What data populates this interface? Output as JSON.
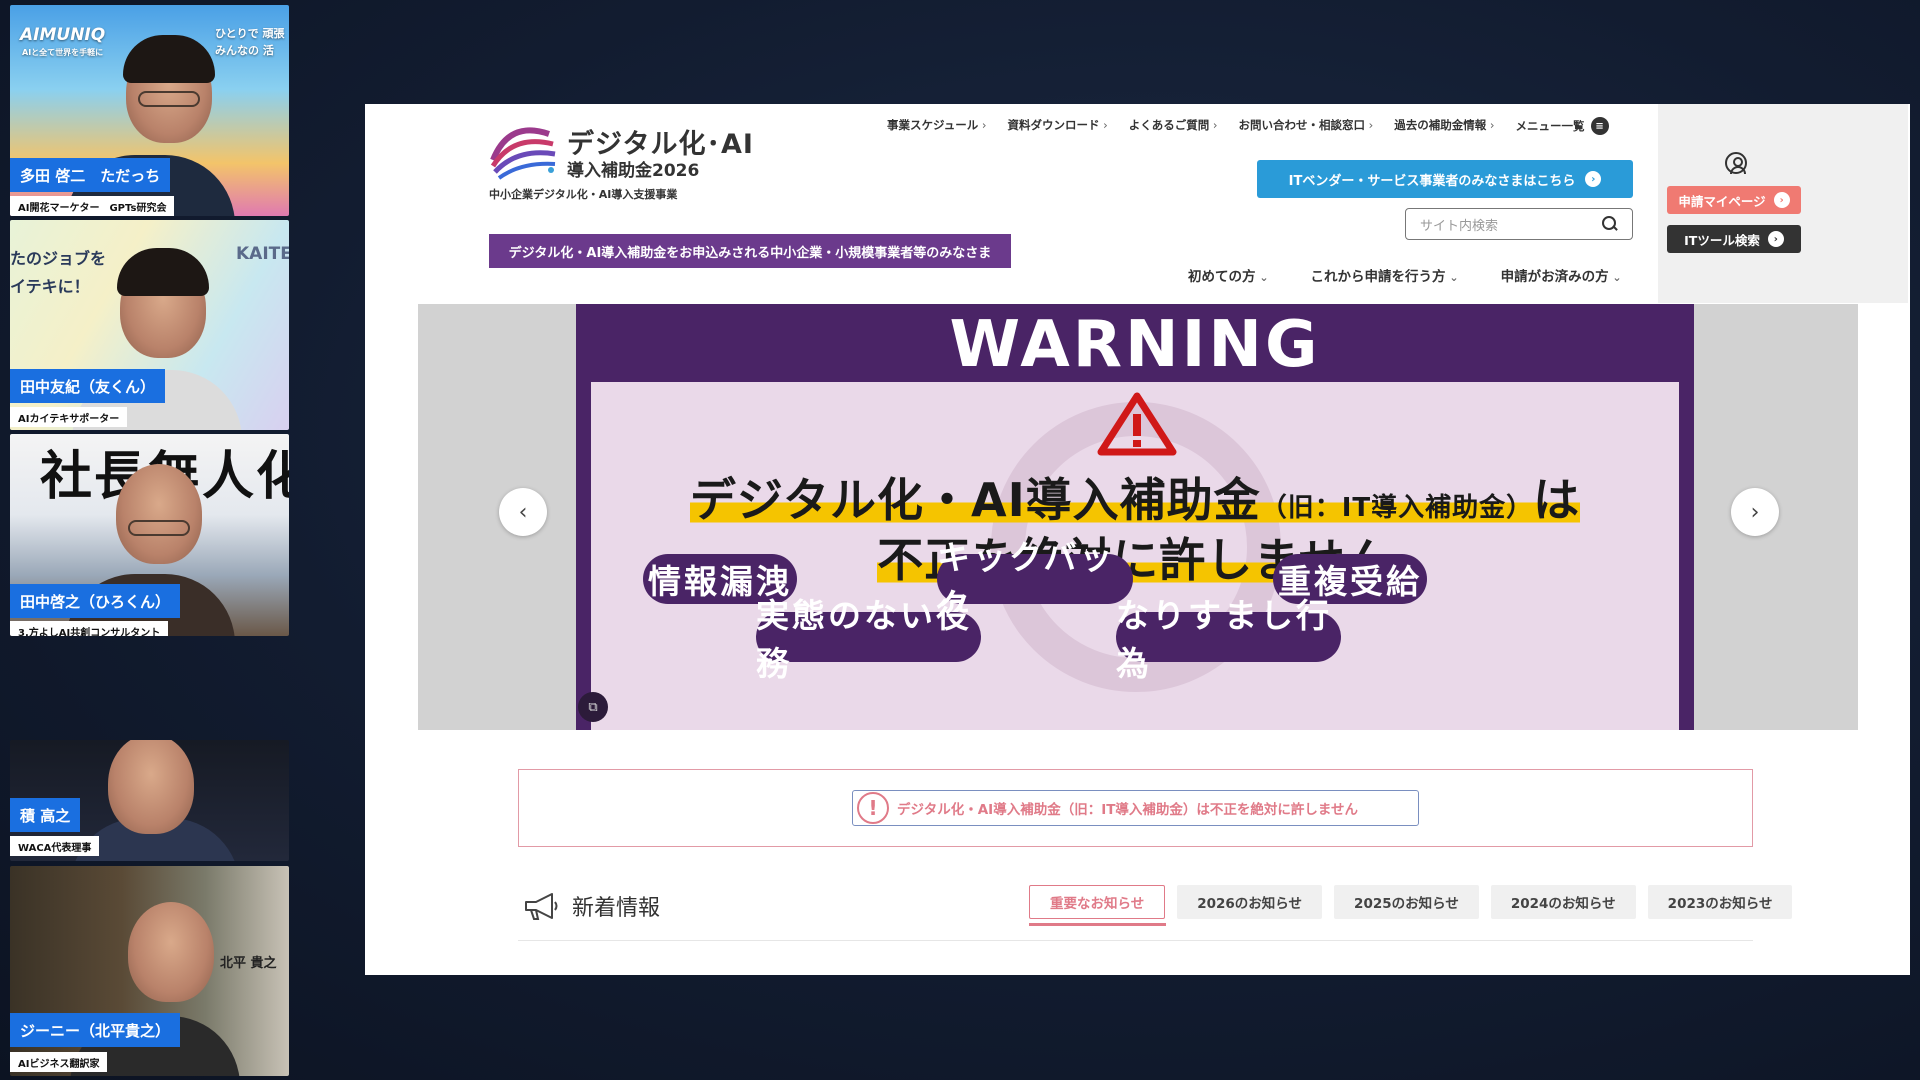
{
  "participants": [
    {
      "name": "多田 啓二　ただっち",
      "title": "AI開花マーケター　GPTs研究会",
      "overlay_brand": "AIMUNIQ",
      "overlay_tagline": "AIと全て世界を手軽に",
      "overlay_right": "ひとりで 頑張\nみんなの 活"
    },
    {
      "name": "田中友紀（友くん）",
      "title": "AIカイテキサポーター",
      "overlay_left": "たのジョブを\nイテキに！",
      "overlay_right": "KAITE"
    },
    {
      "name": "田中啓之（ひろくん）",
      "title": "3.方よしAI共創コンサルタント",
      "overlay_top": "社長無人化"
    },
    {
      "name": "積 高之",
      "title": "WACA代表理事"
    },
    {
      "name": "ジーニー（北平貴之）",
      "title": "AIビジネス翻訳家",
      "overlay_right": "北平 貴之"
    }
  ],
  "site": {
    "logo_line1": "デジタル化･AI",
    "logo_line2": "導入補助金2026",
    "logo_sub": "中小企業デジタル化・AI導入支援事業",
    "top_nav": [
      "事業スケジュール",
      "資料ダウンロード",
      "よくあるご質問",
      "お問い合わせ・相談窓口",
      "過去の補助金情報"
    ],
    "menu_all": "メニュー一覧",
    "vendor_button": "ITベンダー・サービス事業者のみなさまはこちら",
    "search_placeholder": "サイト内検索",
    "purple_banner": "デジタル化・AI導入補助金をお申込みされる中小企業・小規模事業者等のみなさま",
    "main_nav": [
      "初めての方",
      "これから申請を行う方",
      "申請がお済みの方"
    ],
    "mypage_button": "申請マイページ",
    "tool_search_button": "ITツール検索",
    "slide": {
      "title": "WARNING",
      "headline_main": "デジタル化・AI導入補助金",
      "headline_small": "（旧：IT導入補助金）",
      "headline_tail": "は",
      "headline2": "不正を絶対に許しません",
      "pills": [
        "情報漏洩",
        "キックバック",
        "重複受給",
        "実態のない役務",
        "なりすまし行為"
      ]
    },
    "alert_text": "デジタル化・AI導入補助金（旧：IT導入補助金）は不正を絶対に許しません",
    "news_title": "新着情報",
    "news_tabs": [
      "重要なお知らせ",
      "2026のお知らせ",
      "2025のお知らせ",
      "2024のお知らせ",
      "2023のお知らせ"
    ],
    "colors": {
      "purple": "#6b3a8c",
      "vendor_blue": "#2a9bd8",
      "mypage_pink": "#f07a72",
      "highlight": "#f5c400",
      "alert_pink": "#e07a88"
    }
  }
}
